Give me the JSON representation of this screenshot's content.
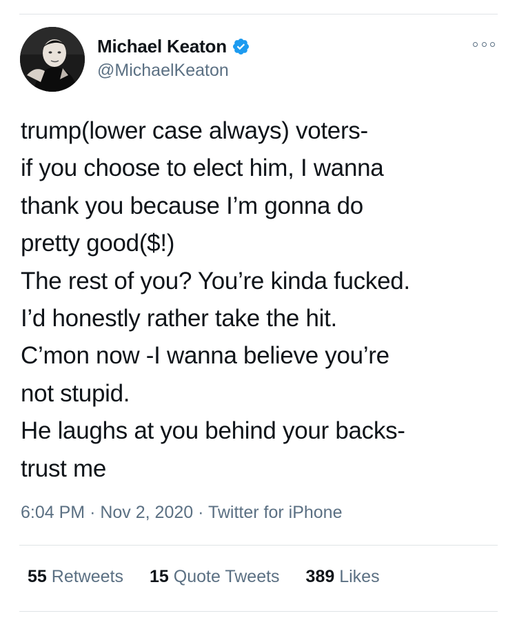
{
  "tweet": {
    "author": {
      "display_name": "Michael Keaton",
      "handle": "@MichaelKeaton",
      "verified": true,
      "avatar_icon": "profile-photo"
    },
    "more_icon": "more-options-icon",
    "text": "trump(lower case always) voters-\nif you choose to elect him, I wanna\nthank you because I’m gonna do\npretty good($!)\nThe rest of you? You’re kinda fucked.\nI’d honestly rather take the hit.\nC’mon now -I wanna believe you’re\nnot stupid.\nHe laughs at you behind your backs-\ntrust me",
    "time": "6:04 PM",
    "date": "Nov 2, 2020",
    "source": "Twitter for iPhone",
    "separator": "·",
    "stats": {
      "retweets": {
        "count": "55",
        "label": "Retweets"
      },
      "quote_tweets": {
        "count": "15",
        "label": "Quote Tweets"
      },
      "likes": {
        "count": "389",
        "label": "Likes"
      }
    }
  },
  "colors": {
    "text_primary": "#0f1419",
    "text_secondary": "#5b7083",
    "verified_blue": "#1d9bf0",
    "divider": "#dfe3e6"
  }
}
